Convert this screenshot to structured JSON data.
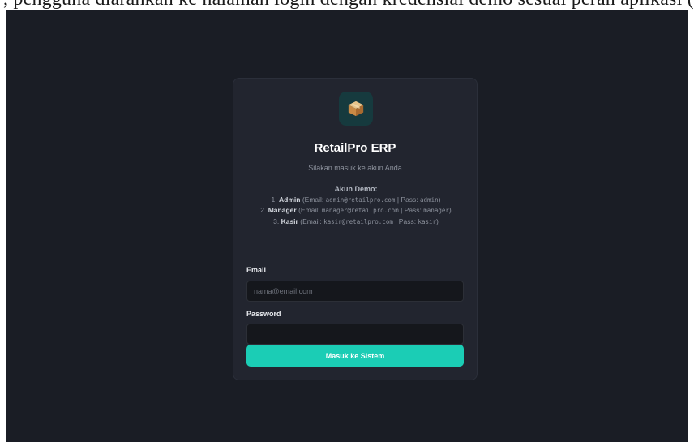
{
  "top_strip": {
    "text": ", pengguna diarahkan ke halaman login dengan kredensial demo sesuai peran aplikasi (yang"
  },
  "brand": {
    "icon": "package-box-icon",
    "title": "RetailPro ERP",
    "subtitle": "Silakan masuk ke akun Anda"
  },
  "demo": {
    "heading": "Akun Demo:",
    "accounts": [
      {
        "prefix": "1.",
        "role": "Admin",
        "email_label": "(Email:",
        "email": "admin@retailpro.com",
        "sep": "| Pass:",
        "pass": "admin",
        "close": ")"
      },
      {
        "prefix": "2.",
        "role": "Manager",
        "email_label": "(Email:",
        "email": "manager@retailpro.com",
        "sep": "| Pass:",
        "pass": "manager",
        "close": ")"
      },
      {
        "prefix": "3.",
        "role": "Kasir",
        "email_label": "(Email:",
        "email": "kasir@retailpro.com",
        "sep": "| Pass:",
        "pass": "kasir",
        "close": ")"
      }
    ]
  },
  "form": {
    "email_label": "Email",
    "email_placeholder": "nama@email.com",
    "email_value": "",
    "password_label": "Password",
    "password_placeholder": "",
    "password_value": "",
    "submit_label": "Masuk ke Sistem"
  },
  "colors": {
    "background": "#1a1d25",
    "card": "#22252f",
    "accent": "#1bcdb5",
    "input_bg": "#15171c"
  }
}
